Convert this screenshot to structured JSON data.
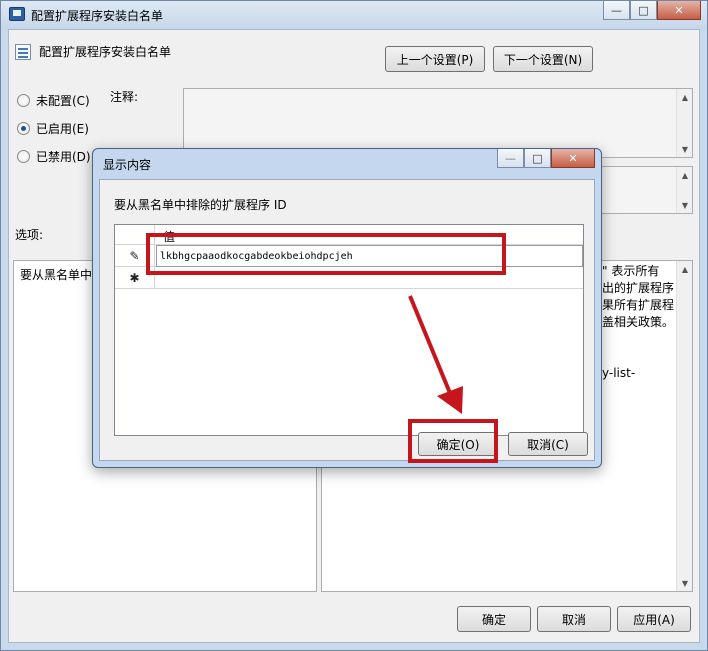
{
  "window": {
    "title": "配置扩展程序安装白名单",
    "controls": {
      "minimize": "—",
      "maximize": "□",
      "close": "✕"
    }
  },
  "policy": {
    "name": "配置扩展程序安装白名单",
    "prev_button": "上一个设置(P)",
    "next_button": "下一个设置(N)"
  },
  "state": {
    "options": [
      {
        "label": "未配置(C)",
        "checked": false
      },
      {
        "label": "已启用(E)",
        "checked": true
      },
      {
        "label": "已禁用(D)",
        "checked": false
      }
    ]
  },
  "comment": {
    "label": "注释:"
  },
  "options_label": "选项:",
  "left_panel": {
    "text": "要从黑名单中"
  },
  "right_panel": {
    "lines": [
      "\" 表示所有",
      "出的扩展程序",
      "果所有扩展程",
      "盖相关政策。",
      "",
      "y-list-"
    ]
  },
  "footer": {
    "ok": "确定",
    "cancel": "取消",
    "apply": "应用(A)"
  },
  "dialog": {
    "title": "显示内容",
    "description": "要从黑名单中排除的扩展程序 ID",
    "column_header": "值",
    "rows": [
      {
        "marker": "✎",
        "value": "lkbhgcpaaodkocgabdeokbeiohdpcjeh"
      },
      {
        "marker": "✱",
        "value": ""
      }
    ],
    "ok_button": "确定(O)",
    "cancel_button": "取消(C)"
  },
  "colors": {
    "annotation": "#c4161c"
  }
}
